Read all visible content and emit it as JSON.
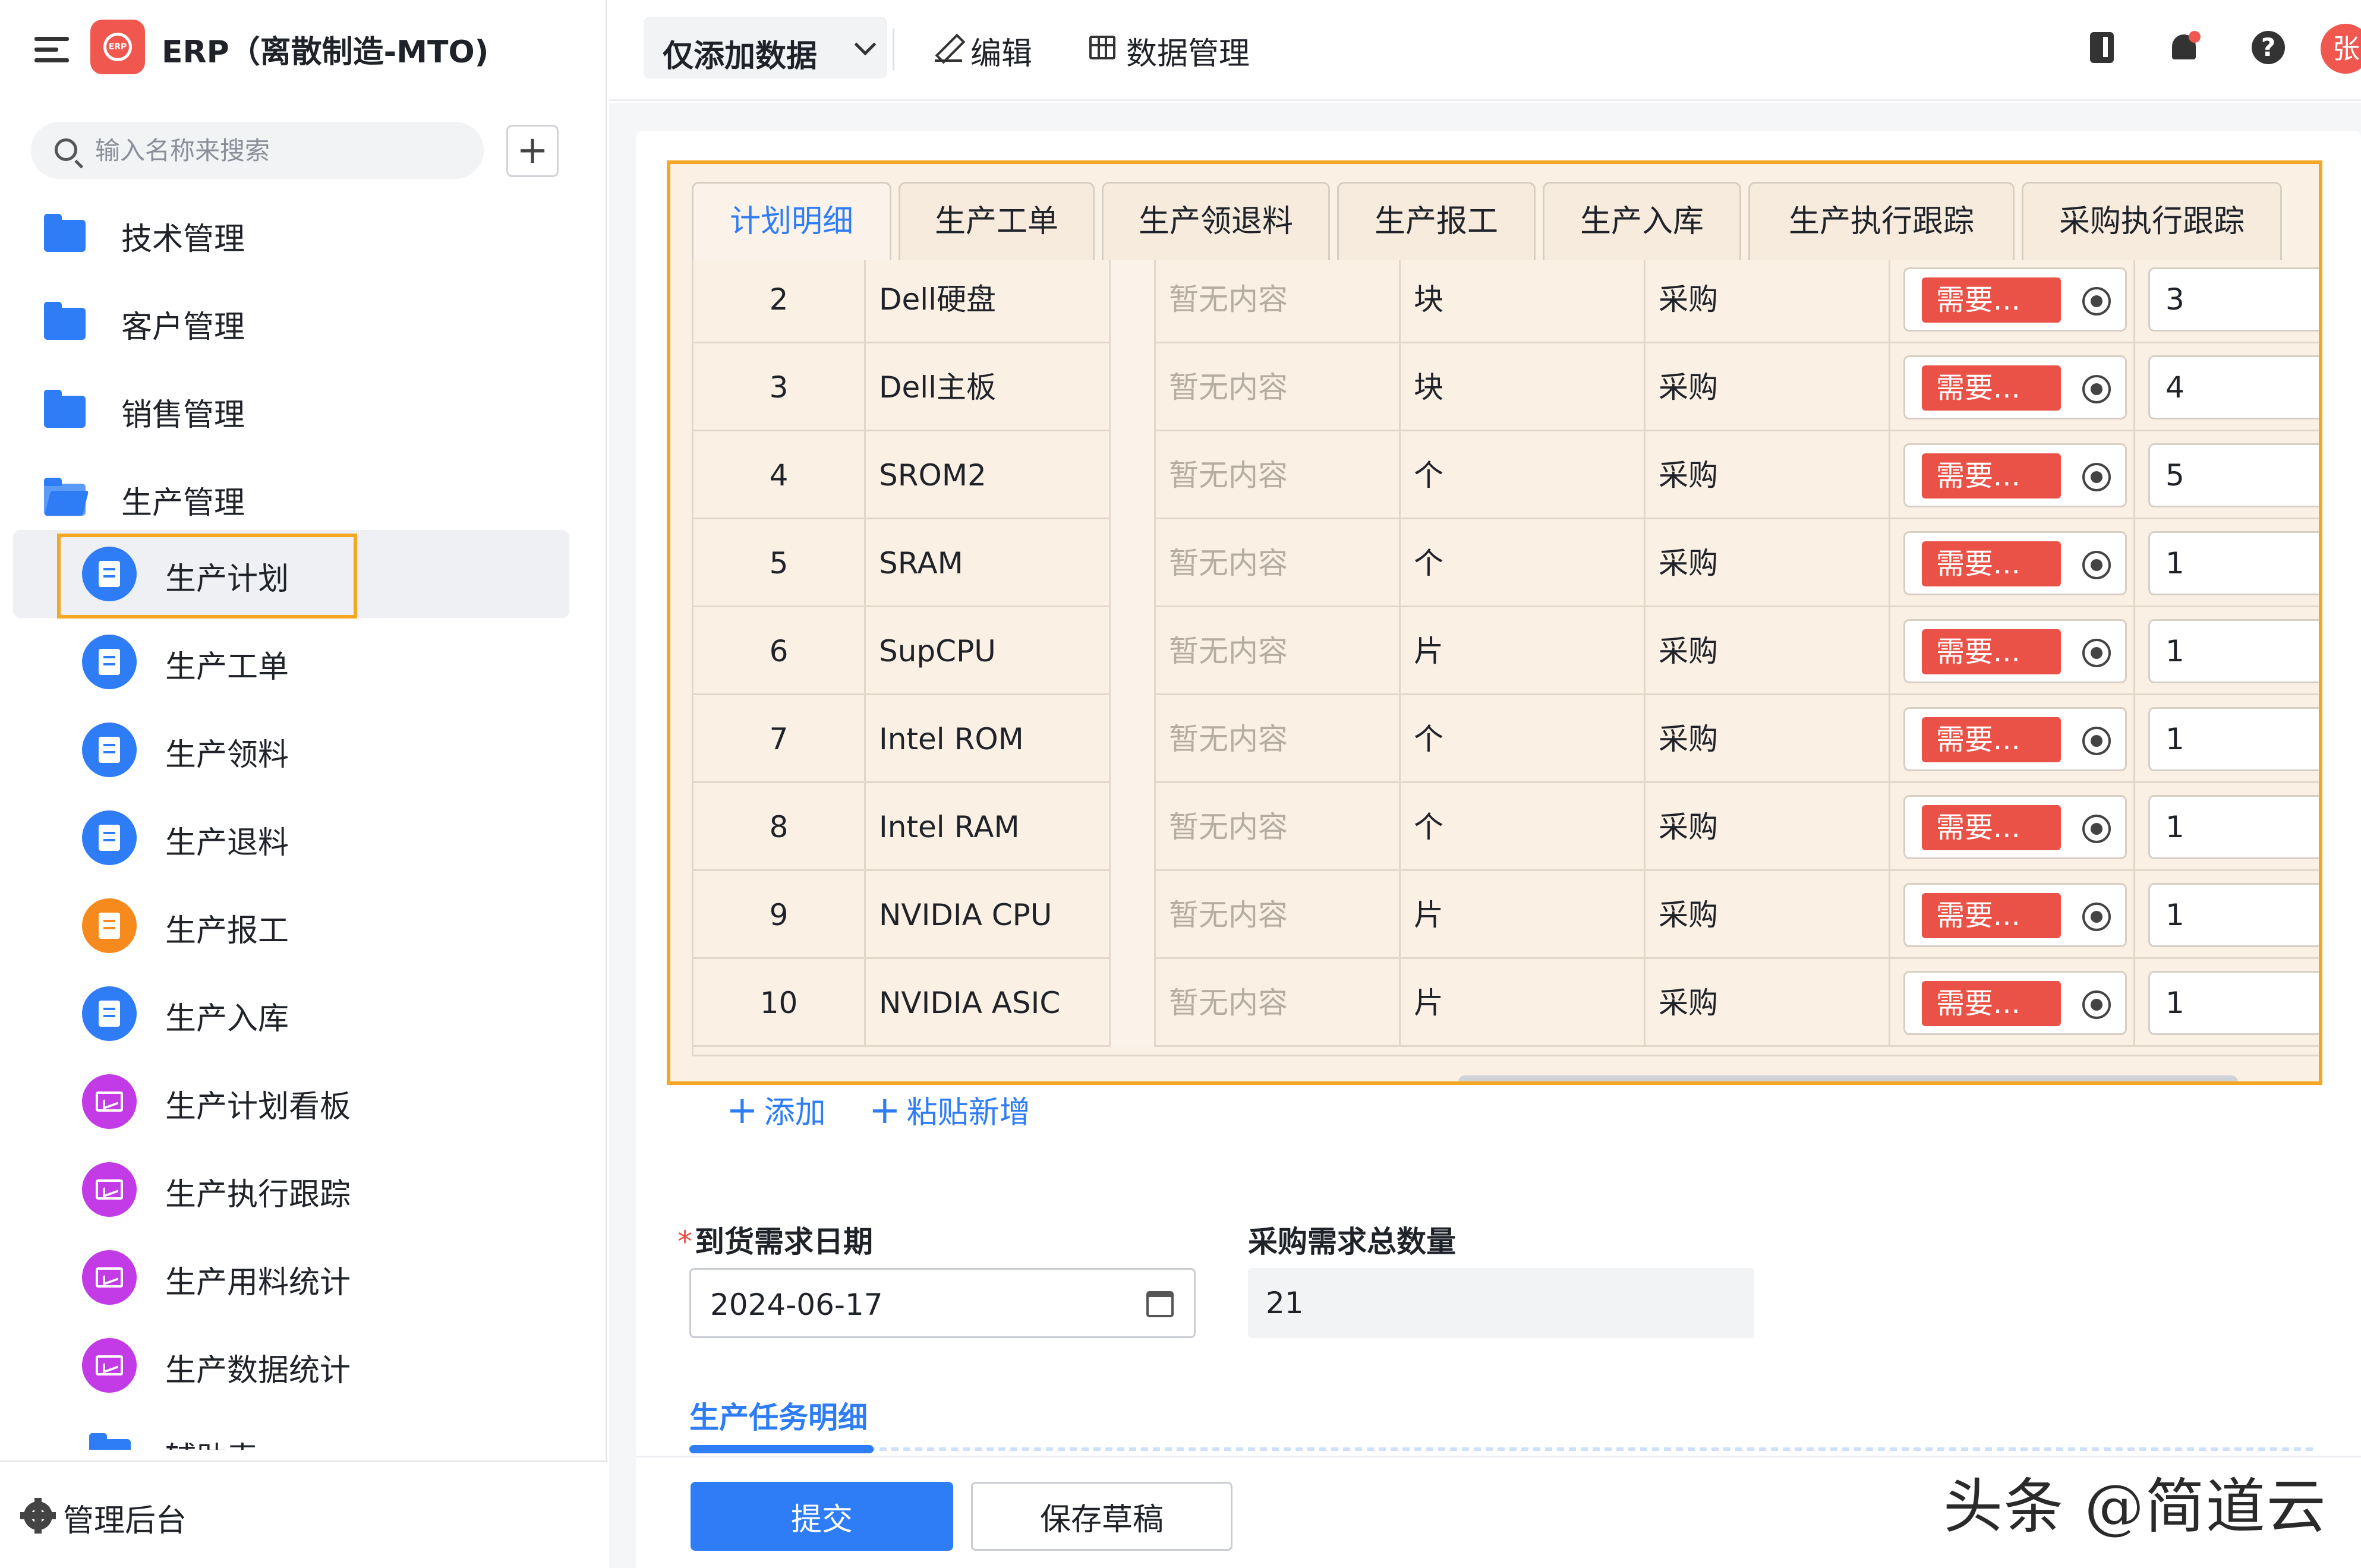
{
  "app": {
    "title": "ERP（离散制造-MTO)",
    "logo_text": "ERP"
  },
  "sidebar": {
    "search_placeholder": "输入名称来搜索",
    "add_label": "+",
    "folders": [
      {
        "label": "技术管理",
        "icon": "folder-icon"
      },
      {
        "label": "客户管理",
        "icon": "folder-icon"
      },
      {
        "label": "销售管理",
        "icon": "folder-icon"
      },
      {
        "label": "生产管理",
        "icon": "folder-open-icon"
      }
    ],
    "items": [
      {
        "label": "生产计划",
        "icon": "document-icon",
        "color": "#2f7df6",
        "selected": true
      },
      {
        "label": "生产工单",
        "icon": "document-icon",
        "color": "#2f7df6"
      },
      {
        "label": "生产领料",
        "icon": "document-icon",
        "color": "#2f7df6"
      },
      {
        "label": "生产退料",
        "icon": "document-icon",
        "color": "#2f7df6"
      },
      {
        "label": "生产报工",
        "icon": "report-icon",
        "color": "#f78a1d"
      },
      {
        "label": "生产入库",
        "icon": "document-icon",
        "color": "#2f7df6"
      },
      {
        "label": "生产计划看板",
        "icon": "dashboard-icon",
        "color": "#c23be6"
      },
      {
        "label": "生产执行跟踪",
        "icon": "dashboard-icon",
        "color": "#c23be6"
      },
      {
        "label": "生产用料统计",
        "icon": "dashboard-icon",
        "color": "#c23be6"
      },
      {
        "label": "生产数据统计",
        "icon": "dashboard-icon",
        "color": "#c23be6"
      }
    ],
    "partial_folder": "辅助表",
    "footer_label": "管理后台"
  },
  "topbar": {
    "mode_label": "仅添加数据",
    "edit_label": "编辑",
    "data_mgmt_label": "数据管理",
    "help_label": "?",
    "avatar_text": "张"
  },
  "subform": {
    "tabs": [
      "计划明细",
      "生产工单",
      "生产领退料",
      "生产报工",
      "生产入库",
      "生产执行跟踪",
      "采购执行跟踪"
    ],
    "active_tab": 0,
    "rows": [
      {
        "no": "2",
        "name": "Dell硬盘",
        "spec": "暂无内容",
        "unit": "块",
        "source": "采购",
        "req": "需要...",
        "qty": "3"
      },
      {
        "no": "3",
        "name": "Dell主板",
        "spec": "暂无内容",
        "unit": "块",
        "source": "采购",
        "req": "需要...",
        "qty": "4"
      },
      {
        "no": "4",
        "name": "SROM2",
        "spec": "暂无内容",
        "unit": "个",
        "source": "采购",
        "req": "需要...",
        "qty": "5"
      },
      {
        "no": "5",
        "name": "SRAM",
        "spec": "暂无内容",
        "unit": "个",
        "source": "采购",
        "req": "需要...",
        "qty": "1"
      },
      {
        "no": "6",
        "name": "SupCPU",
        "spec": "暂无内容",
        "unit": "片",
        "source": "采购",
        "req": "需要...",
        "qty": "1"
      },
      {
        "no": "7",
        "name": "Intel ROM",
        "spec": "暂无内容",
        "unit": "个",
        "source": "采购",
        "req": "需要...",
        "qty": "1"
      },
      {
        "no": "8",
        "name": "Intel RAM",
        "spec": "暂无内容",
        "unit": "个",
        "source": "采购",
        "req": "需要...",
        "qty": "1"
      },
      {
        "no": "9",
        "name": "NVIDIA CPU",
        "spec": "暂无内容",
        "unit": "片",
        "source": "采购",
        "req": "需要...",
        "qty": "1"
      },
      {
        "no": "10",
        "name": "NVIDIA ASIC",
        "spec": "暂无内容",
        "unit": "片",
        "source": "采购",
        "req": "需要...",
        "qty": "1"
      }
    ],
    "add_label": "添加",
    "paste_label": "粘贴新增"
  },
  "form": {
    "arrival_date_label": "到货需求日期",
    "arrival_date_value": "2024-06-17",
    "total_qty_label": "采购需求总数量",
    "total_qty_value": "21",
    "section_title": "生产任务明细"
  },
  "actions": {
    "submit_label": "提交",
    "draft_label": "保存草稿"
  },
  "watermark": "头条 @简道云",
  "colors": {
    "accent": "#2f7df6",
    "highlight_border": "#f5a623",
    "tag_red": "#ea5247"
  }
}
